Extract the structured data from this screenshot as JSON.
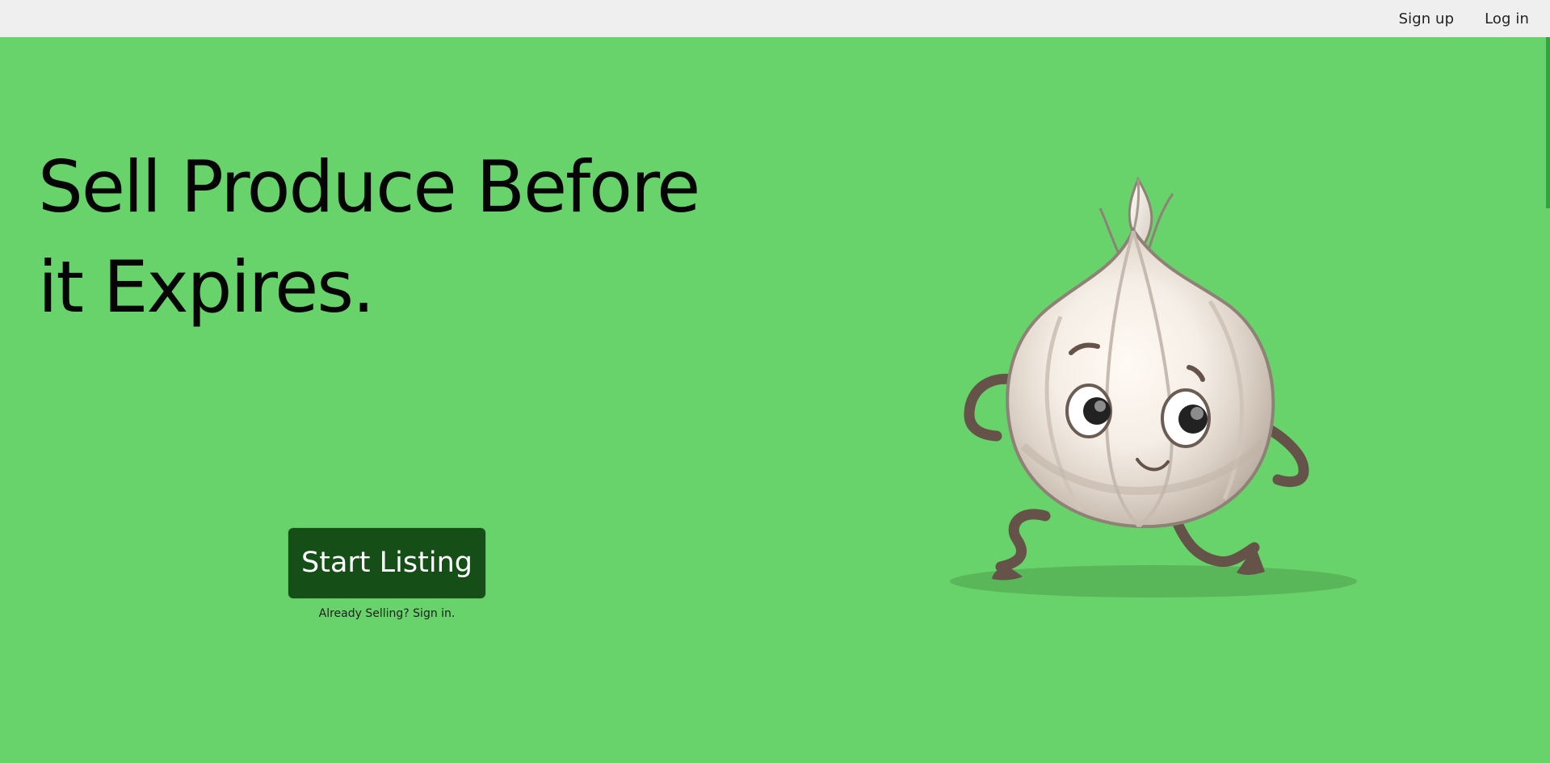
{
  "nav": {
    "signup_label": "Sign up",
    "login_label": "Log in"
  },
  "hero": {
    "headline": "Sell Produce Before it Expires.",
    "cta_label": "Start Listing",
    "signin_prompt": "Already Selling? Sign in."
  },
  "colors": {
    "topbar_background": "#efefef",
    "hero_background": "#68d36a",
    "cta_background": "#154f17",
    "scroll_accent": "#2fa53c"
  },
  "illustration": {
    "icon_name": "garlic-mascot-icon"
  }
}
